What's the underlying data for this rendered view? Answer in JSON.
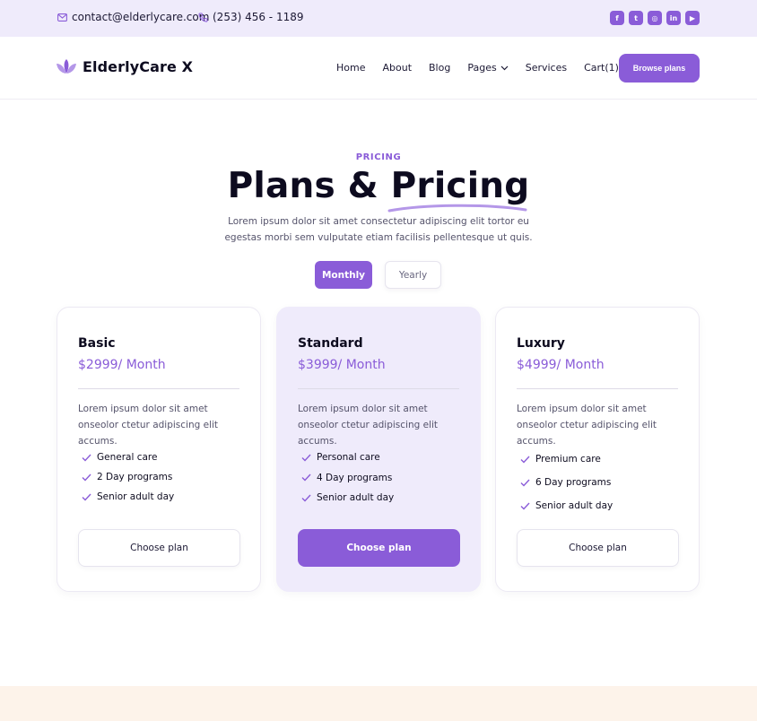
{
  "topbar": {
    "email": "contact@elderlycare.com",
    "phone": "(253) 456 - 1189",
    "social": [
      {
        "icon": "facebook-icon",
        "glyph": "f"
      },
      {
        "icon": "twitter-icon",
        "glyph": "t"
      },
      {
        "icon": "instagram-icon",
        "glyph": "◎"
      },
      {
        "icon": "linkedin-icon",
        "glyph": "in"
      },
      {
        "icon": "youtube-icon",
        "glyph": "▶"
      }
    ]
  },
  "nav": {
    "brand": "ElderlyCare X",
    "items": [
      "Home",
      "About",
      "Blog",
      "Pages",
      "Services",
      "Cart(1)"
    ],
    "cta": "Browse plans"
  },
  "hero": {
    "eyebrow": "PRICING",
    "title_start": "Plans & ",
    "title_highlight": "Pricing",
    "subtitle": "Lorem ipsum dolor sit amet consectetur adipiscing elit tortor eu egestas morbi sem vulputate etiam facilisis pellentesque ut quis.",
    "toggle": {
      "monthly": "Monthly",
      "yearly": "Yearly",
      "selected": "Monthly"
    }
  },
  "plans": [
    {
      "name": "Basic",
      "price": "$2999/ Month",
      "description": "Lorem ipsum dolor sit amet onseolor ctetur adipiscing elit accums.",
      "features": [
        "General care",
        "2 Day programs",
        "Senior adult day"
      ],
      "button": "Choose plan"
    },
    {
      "name": "Standard",
      "price": "$3999/ Month",
      "description": "Lorem ipsum dolor sit amet onseolor ctetur adipiscing elit accums.",
      "features": [
        "Personal care",
        "4 Day programs",
        "Senior adult day"
      ],
      "button": "Choose plan"
    },
    {
      "name": "Luxury",
      "price": "$4999/ Month",
      "description": "Lorem ipsum dolor sit amet onseolor ctetur adipiscing elit accums.",
      "features": [
        "Premium care",
        "6 Day programs",
        "Senior adult day"
      ],
      "button": "Choose plan"
    }
  ],
  "colors": {
    "accent": "#8a5cd8",
    "accent_light": "#efebfb",
    "footer_band": "#fdf3ea"
  }
}
